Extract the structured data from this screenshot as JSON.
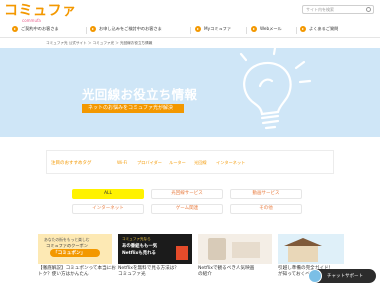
{
  "header": {
    "logo_text": "コミュファ",
    "logo_sub": "commufa",
    "search_placeholder": "サイト内を検索"
  },
  "nav": [
    {
      "label": "ご契約中のお客さま"
    },
    {
      "label": "お申し込みをご検討中のお客さま"
    },
    {
      "label": "Myコミュファ"
    },
    {
      "label": "Webメール"
    },
    {
      "label": "よくあるご質問"
    }
  ],
  "breadcrumb": "コミュファ光 公式サイト ＞ コミュファ光 ＞ 光回線お役立ち情報",
  "hero": {
    "title": "光回線お役立ち情報",
    "subtitle": "ネットのお悩みをコミュファ光が解決"
  },
  "tags": {
    "label": "注目のおすすめタグ",
    "items": [
      "Wi-Fi",
      "プロバイダー",
      "ルーター",
      "光回線",
      "インターネット"
    ]
  },
  "categories": [
    {
      "label": "ALL"
    },
    {
      "label": "光回線サービス"
    },
    {
      "label": "動画サービス"
    },
    {
      "label": "インターネット"
    },
    {
      "label": "ゲーム関連"
    },
    {
      "label": "その他"
    }
  ],
  "cards": [
    {
      "banner_line1": "あなたの街をもっと楽しむ",
      "banner_line2": "コミュファのクーポン",
      "banner_highlight": "「コミュポン」",
      "caption_line1": "【徹底解説】コミュポンって本当にお",
      "caption_line2": "トク？使い方はかんたん"
    },
    {
      "banner_line1": "コミュファ光なら",
      "banner_line2": "あの番組もも一気",
      "banner_highlight": "Netflixも見れる",
      "caption_line1": "Netflixを無料で見る方法は？",
      "caption_line2": "コミュファ光"
    },
    {
      "banner_line1": "",
      "banner_line2": "",
      "banner_highlight": "",
      "caption_line1": "Netflixで観るべき人気映画",
      "caption_line2": "の紹介"
    },
    {
      "banner_line1": "",
      "banner_line2": "",
      "banner_highlight": "",
      "caption_line1": "引越し準備の完全ガイド！",
      "caption_line2": "が知っておくべきポイント"
    }
  ],
  "chat": {
    "label": "チャットサポート"
  }
}
